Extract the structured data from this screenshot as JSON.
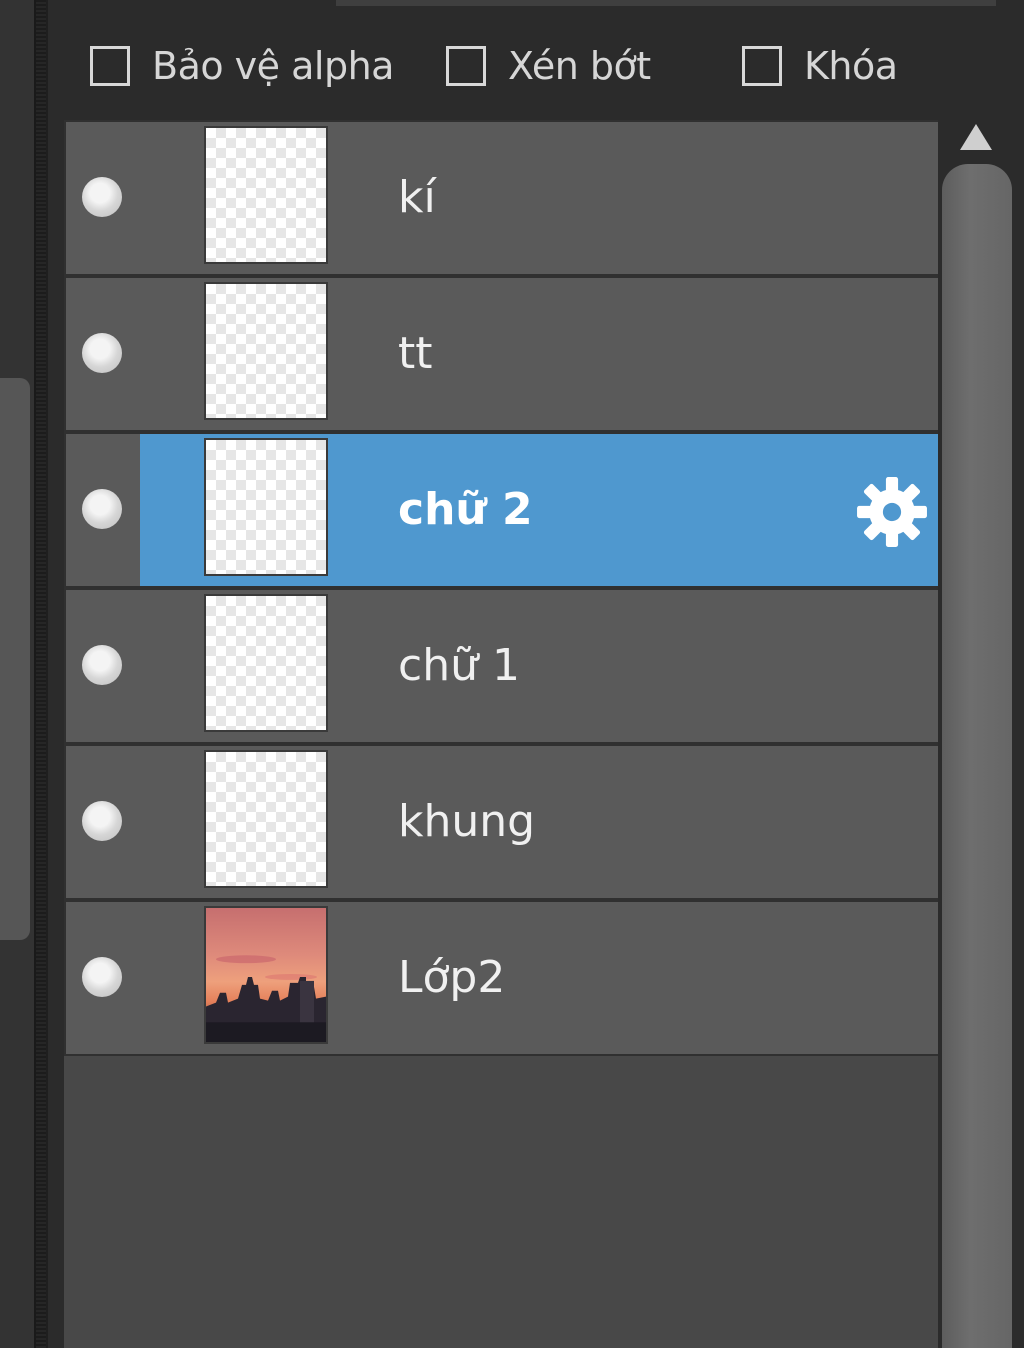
{
  "options": [
    {
      "label": "Bảo vệ alpha",
      "checked": false
    },
    {
      "label": "Xén bớt",
      "checked": false
    },
    {
      "label": "Khóa",
      "checked": false
    }
  ],
  "layers": [
    {
      "name": "kí",
      "visible": true,
      "thumbnail": "transparent",
      "selected": false
    },
    {
      "name": "tt",
      "visible": true,
      "thumbnail": "transparent",
      "selected": false
    },
    {
      "name": "chữ 2",
      "visible": true,
      "thumbnail": "transparent",
      "selected": true
    },
    {
      "name": "chữ 1",
      "visible": true,
      "thumbnail": "transparent",
      "selected": false
    },
    {
      "name": "khung",
      "visible": true,
      "thumbnail": "transparent",
      "selected": false
    },
    {
      "name": "Lớp2",
      "visible": true,
      "thumbnail": "sunset-city-photo",
      "selected": false
    }
  ],
  "colors": {
    "selected_row": "#4f98cf",
    "row": "#5a5a5a",
    "panel_background": "#2b2b2b"
  },
  "icons": {
    "visibility": "visibility-dot-icon",
    "settings": "gear-icon",
    "scroll_up": "triangle-up-icon"
  }
}
